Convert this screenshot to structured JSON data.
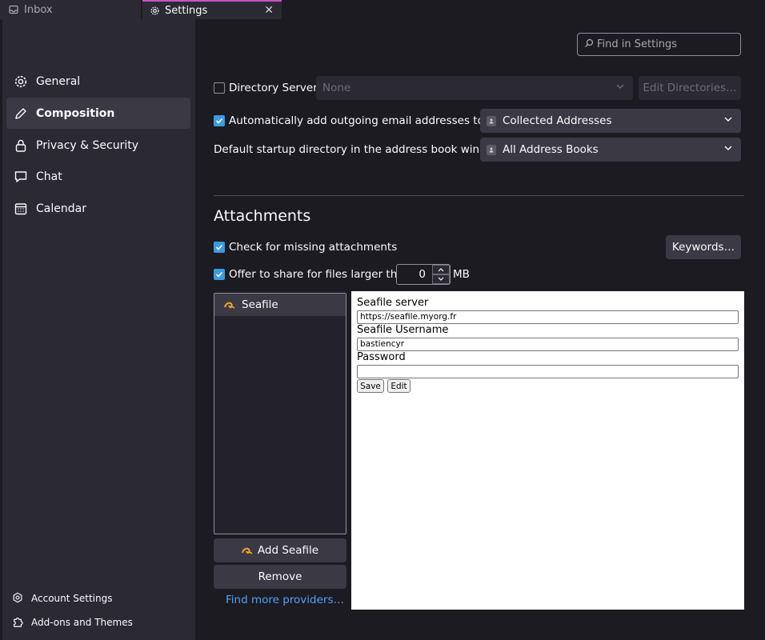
{
  "tabs": [
    {
      "label": "Inbox",
      "icon": "inbox-icon"
    },
    {
      "label": "Settings",
      "icon": "gear-icon"
    }
  ],
  "sidebar": {
    "items": [
      {
        "label": "General",
        "icon": "gear-icon"
      },
      {
        "label": "Composition",
        "icon": "pencil-icon",
        "active": true
      },
      {
        "label": "Privacy & Security",
        "icon": "lock-icon"
      },
      {
        "label": "Chat",
        "icon": "chat-icon"
      },
      {
        "label": "Calendar",
        "icon": "calendar-icon"
      }
    ],
    "bottom": [
      {
        "label": "Account Settings",
        "icon": "account-icon"
      },
      {
        "label": "Add-ons and Themes",
        "icon": "puzzle-icon"
      }
    ]
  },
  "search": {
    "placeholder": "Find in Settings"
  },
  "addressing": {
    "directory_server_label": "Directory Server:",
    "directory_server_checked": false,
    "directory_server_value": "None",
    "edit_directories_label": "Edit Directories…",
    "auto_add_label": "Automatically add outgoing email addresses to my:",
    "auto_add_checked": true,
    "auto_add_value": "Collected Addresses",
    "startup_dir_label": "Default startup directory in the address book window:",
    "startup_dir_value": "All Address Books"
  },
  "attachments": {
    "heading": "Attachments",
    "missing_label": "Check for missing attachments",
    "missing_checked": true,
    "keywords_label": "Keywords…",
    "share_label": "Offer to share for files larger than",
    "share_checked": true,
    "share_value": "0",
    "share_unit": "MB",
    "providers": [
      {
        "label": "Seafile",
        "icon": "seafile-icon"
      }
    ],
    "add_button": "Add Seafile",
    "remove_button": "Remove",
    "more_link": "Find more providers…"
  },
  "seafile_panel": {
    "server_label": "Seafile server",
    "server_value": "https://seafile.myorg.fr",
    "username_label": "Seafile Username",
    "username_value": "bastiencyr",
    "password_label": "Password",
    "password_value": "",
    "save_label": "Save",
    "edit_label": "Edit"
  },
  "colors": {
    "accent": "#3b9be0",
    "tab_highlight": "#c454c3",
    "link": "#4fa3f7"
  }
}
